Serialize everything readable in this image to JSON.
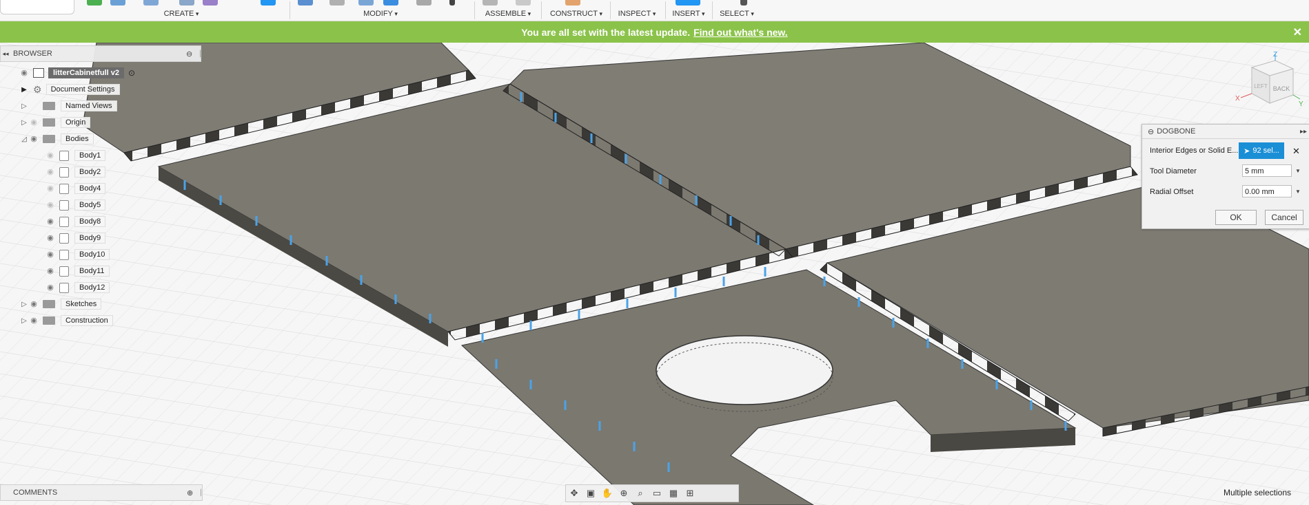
{
  "toolbar": {
    "groups": [
      {
        "label": "CREATE"
      },
      {
        "label": "MODIFY"
      },
      {
        "label": "ASSEMBLE"
      },
      {
        "label": "CONSTRUCT"
      },
      {
        "label": "INSPECT"
      },
      {
        "label": "INSERT"
      },
      {
        "label": "SELECT"
      }
    ]
  },
  "banner": {
    "message": "You are all set with the latest update.",
    "link": "Find out what's new."
  },
  "browser": {
    "title": "BROWSER",
    "root": "litterCabinetfull v2",
    "items": [
      {
        "label": "Document Settings",
        "icon": "gear-icon"
      },
      {
        "label": "Named Views",
        "icon": "folder-icon"
      },
      {
        "label": "Origin",
        "icon": "folder-icon"
      },
      {
        "label": "Bodies",
        "icon": "folder-icon"
      },
      {
        "label": "Sketches",
        "icon": "folder-icon"
      },
      {
        "label": "Construction",
        "icon": "folder-icon"
      }
    ],
    "bodies": [
      "Body1",
      "Body2",
      "Body4",
      "Body5",
      "Body8",
      "Body9",
      "Body10",
      "Body11",
      "Body12"
    ]
  },
  "dogbone": {
    "title": "DOGBONE",
    "fields": {
      "edges_label": "Interior Edges or Solid E...",
      "edges_value": "92 sel...",
      "tool_diameter_label": "Tool Diameter",
      "tool_diameter_value": "5 mm",
      "radial_offset_label": "Radial Offset",
      "radial_offset_value": "0.00 mm"
    },
    "ok": "OK",
    "cancel": "Cancel"
  },
  "viewcube": {
    "face": "BACK",
    "left_face": "LEFT",
    "axis_z": "Z",
    "axis_x": "X",
    "axis_y": "Y"
  },
  "comments": {
    "title": "COMMENTS"
  },
  "status": "Multiple selections",
  "colors": {
    "banner": "#8bc34a",
    "accent": "#1b8fd6",
    "body": "#7d7a72"
  }
}
